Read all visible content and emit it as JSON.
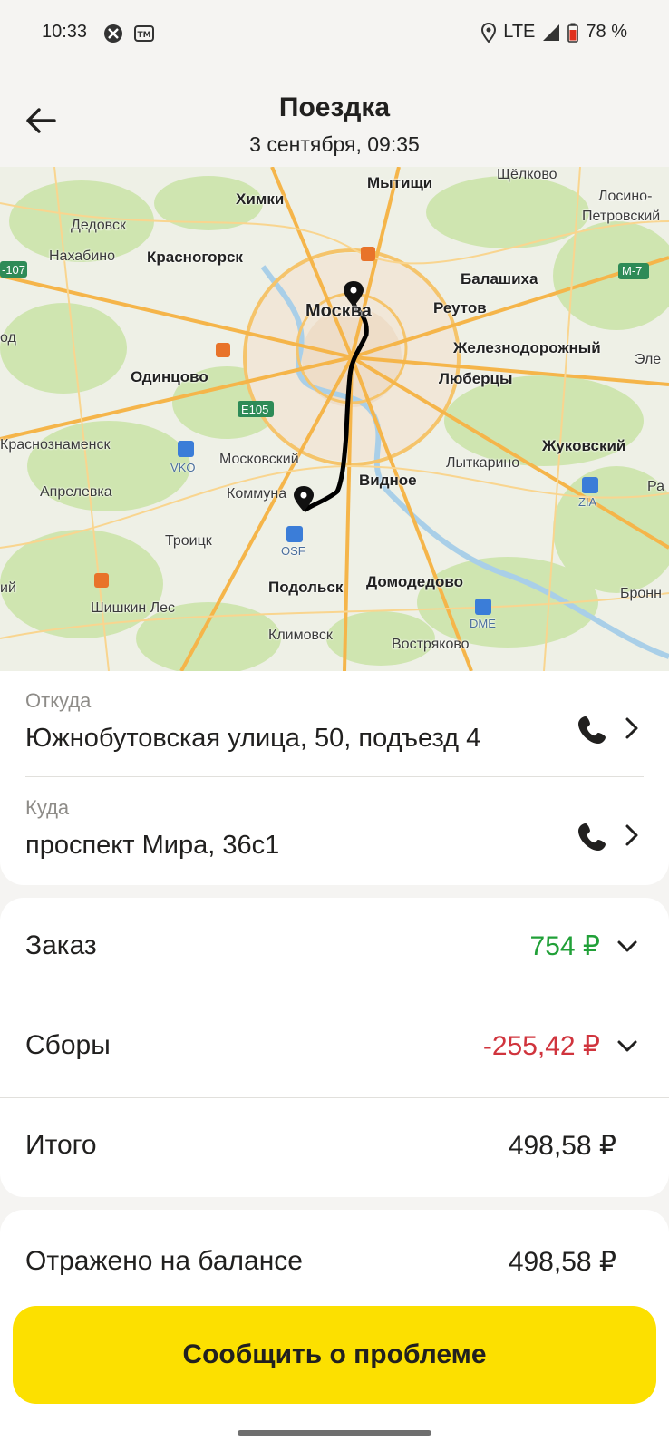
{
  "status_bar": {
    "time": "10:33",
    "network": "LTE",
    "battery": "78 %"
  },
  "header": {
    "title": "Поездка",
    "subtitle": "3 сентября, 09:35"
  },
  "map": {
    "labels": {
      "shchelkovo": "Щёлково",
      "mytishchi": "Мытищи",
      "khimki": "Химки",
      "losino": "Лосино-",
      "petrovsky": "Петровский",
      "dedovsk": "Дедовск",
      "nakhabino": "Нахабино",
      "krasnogorsk": "Красногорск",
      "m107": "-107",
      "m7": "M-7",
      "balashikha": "Балашиха",
      "moskva": "Москва",
      "reutov": "Реутов",
      "od": "од",
      "zheleznodorozhny": "Железнодорожный",
      "ele": "Эле",
      "odintsovo": "Одинцово",
      "lyubertsy": "Люберцы",
      "e105": "E105",
      "krasnoznamensk": "Краснознаменск",
      "zhukovsky": "Жуковский",
      "vko": "VKO",
      "moskovsky": "Московский",
      "lytkarino": "Лыткарино",
      "vidnoe": "Видное",
      "aprelevka": "Апрелевка",
      "kommunarka": "Коммуна",
      "zia": "ZIA",
      "ra": "Ра",
      "troitsk": "Троицк",
      "osf": "OSF",
      "iy": "ий",
      "podolsk": "Подольск",
      "domodedovo": "Домодедово",
      "bronn": "Бронн",
      "shishkin": "Шишкин Лес",
      "dme": "DME",
      "klimovsk": "Климовск",
      "vostryakovo": "Востряково"
    }
  },
  "route": {
    "from_label": "Откуда",
    "from_address": "Южнобутовская улица, 50, подъезд 4",
    "to_label": "Куда",
    "to_address": "проспект Мира, 36с1"
  },
  "finance": {
    "order_label": "Заказ",
    "order_value": "754 ₽",
    "fees_label": "Сборы",
    "fees_value": "-255,42 ₽",
    "total_label": "Итого",
    "total_value": "498,58 ₽",
    "balance_label": "Отражено на балансе",
    "balance_value": "498,58 ₽"
  },
  "colors": {
    "positive": "#21a038",
    "negative": "#d0343d",
    "accent": "#fce000"
  },
  "report_button": "Сообщить о проблеме"
}
